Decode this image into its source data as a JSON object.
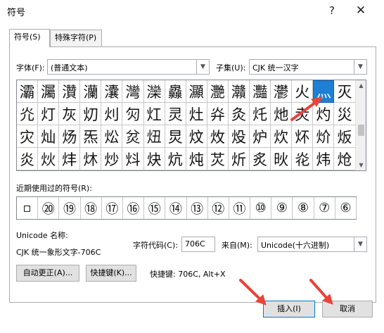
{
  "dialog": {
    "title": "符号",
    "help": "?",
    "close": "✕"
  },
  "tabs": [
    {
      "label": "符号(S)"
    },
    {
      "label": "特殊字符(P)"
    }
  ],
  "font": {
    "label": "字体(F):",
    "value": "(普通文本)"
  },
  "subset": {
    "label": "子集(U):",
    "value": "CJK 统一汉字"
  },
  "grid": {
    "rows": [
      [
        "灞",
        "灟",
        "灒",
        "灡",
        "灢",
        "灣",
        "灤",
        "灥",
        "灦",
        "灧",
        "灨",
        "灩",
        "灪",
        "火",
        "灬",
        "灭"
      ],
      [
        "灮",
        "灯",
        "灰",
        "灱",
        "灲",
        "灳",
        "灴",
        "灵",
        "灶",
        "灷",
        "灸",
        "灹",
        "灺",
        "灻",
        "灼",
        "災"
      ],
      [
        "灾",
        "灿",
        "炀",
        "炁",
        "炂",
        "炃",
        "炄",
        "炅",
        "炆",
        "炇",
        "炈",
        "炉",
        "炊",
        "炋",
        "炌",
        "炍"
      ],
      [
        "炎",
        "炏",
        "炐",
        "炑",
        "炒",
        "炓",
        "炔",
        "炕",
        "炖",
        "炗",
        "炘",
        "炙",
        "炚",
        "炛",
        "炜",
        "炝"
      ]
    ],
    "selected_char": "灬"
  },
  "recent": {
    "label": "近期使用过的符号(R):",
    "items": [
      "▫",
      "⑳",
      "⑲",
      "⑱",
      "⑰",
      "⑯",
      "⑮",
      "⑭",
      "⑬",
      "⑫",
      "⑪",
      "⑩",
      "⑨",
      "⑧",
      "⑦",
      "⑥"
    ]
  },
  "unicode_name": {
    "label": "Unicode 名称:",
    "value": "CJK 统一象形文字-706C"
  },
  "char_code": {
    "label": "字符代码(C):",
    "value": "706C"
  },
  "from": {
    "label": "来自(M):",
    "value": "Unicode(十六进制)"
  },
  "buttons": {
    "autocorrect": "自动更正(A)...",
    "shortcut_key": "快捷键(K)...",
    "shortcut_info": "快捷键: 706C, Alt+X",
    "insert": "插入(I)",
    "cancel": "取消"
  },
  "colors": {
    "selection": "#1e7fd4",
    "accent_arrow": "#e8443a",
    "default_button_border": "#0078d7"
  }
}
